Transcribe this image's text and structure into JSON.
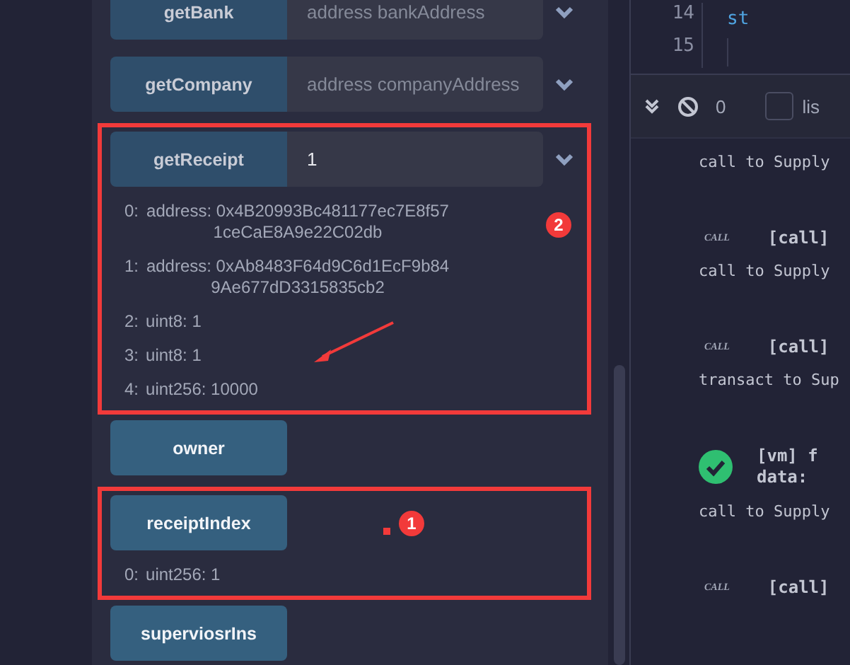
{
  "functions": [
    {
      "name": "getBank",
      "kind": "input",
      "placeholder": "address bankAddress"
    },
    {
      "name": "getCompany",
      "kind": "input",
      "placeholder": "address companyAddress"
    },
    {
      "name": "getReceipt",
      "kind": "input",
      "value": "1",
      "annotation": "2",
      "outputs": [
        {
          "index": "0:",
          "value": "address: 0x4B20993Bc481177ec7E8f571ceCaE8A9e22C02db"
        },
        {
          "index": "1:",
          "value": "address: 0xAb8483F64d9C6d1EcF9b849Ae677dD3315835cb2"
        },
        {
          "index": "2:",
          "value": "uint8: 1"
        },
        {
          "index": "3:",
          "value": "uint8: 1"
        },
        {
          "index": "4:",
          "value": "uint256: 10000"
        }
      ]
    },
    {
      "name": "owner",
      "kind": "call"
    },
    {
      "name": "receiptIndex",
      "kind": "call",
      "annotation": "1",
      "outputs": [
        {
          "index": "0:",
          "value": "uint256: 1"
        }
      ]
    },
    {
      "name": "superviosrIns",
      "kind": "call"
    }
  ],
  "editor": {
    "lines": [
      {
        "number": "14",
        "code": "st"
      },
      {
        "number": "15"
      }
    ]
  },
  "terminal": {
    "pending": "0",
    "filter": {
      "label": "lis",
      "checked": false
    },
    "log": [
      {
        "kind": "text",
        "text": "call to Supply"
      },
      {
        "kind": "call",
        "tag": "CALL",
        "text": "[call]"
      },
      {
        "kind": "text",
        "text": "call to Supply"
      },
      {
        "kind": "call",
        "tag": "CALL",
        "text": "[call]"
      },
      {
        "kind": "text",
        "text": "transact to Sup"
      },
      {
        "kind": "success",
        "lines": [
          "[vm] f",
          "data: "
        ]
      },
      {
        "kind": "text",
        "text": "call to Supply"
      },
      {
        "kind": "call",
        "tag": "CALL",
        "text": "[call]"
      }
    ]
  }
}
